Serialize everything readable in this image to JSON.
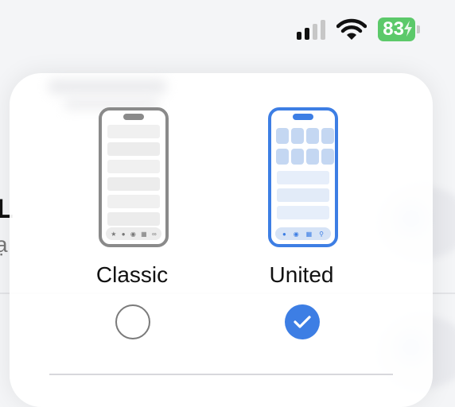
{
  "status_bar": {
    "battery_level": "83",
    "signal_icon": "signal-bars-icon",
    "wifi_icon": "wifi-icon",
    "charging_icon": "bolt-icon"
  },
  "layout_picker": {
    "options": [
      {
        "label": "Classic",
        "selected": false,
        "icon": "classic-phone-layout-icon"
      },
      {
        "label": "United",
        "selected": true,
        "icon": "united-phone-layout-icon"
      }
    ]
  },
  "background": {
    "letter_top": "L",
    "letter_bottom": "ạ"
  },
  "colors": {
    "accent": "#3d7ee4",
    "battery": "#5cc96a",
    "classic_frame": "#8a8a8a",
    "tile": "#c4d7f2"
  }
}
